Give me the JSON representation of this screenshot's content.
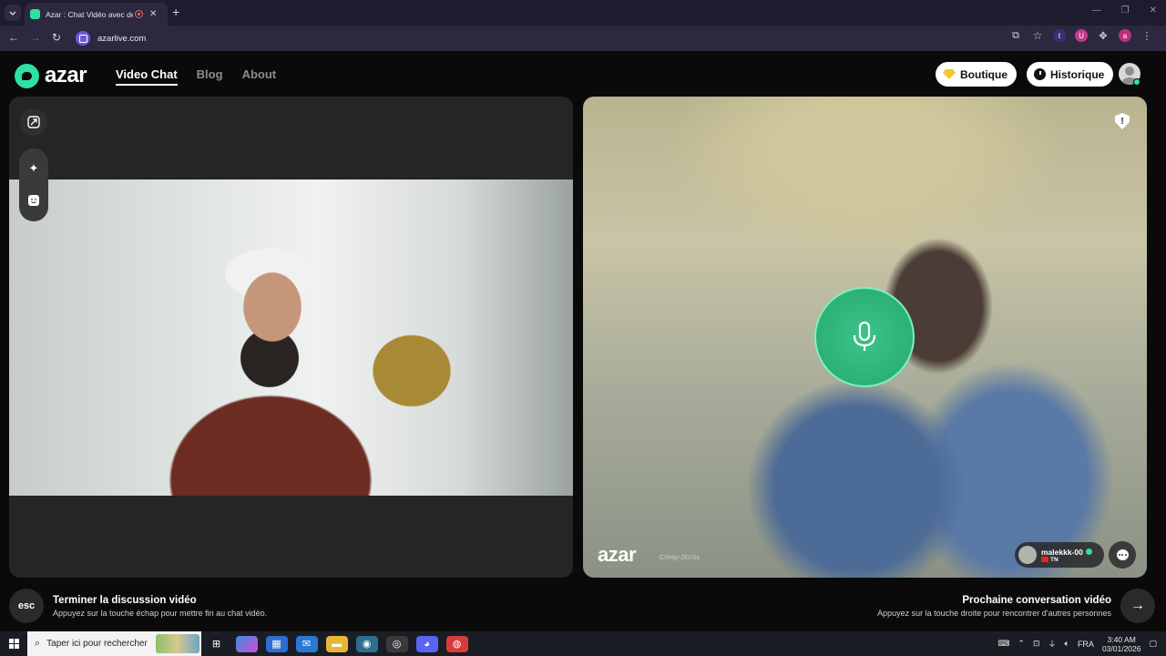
{
  "browser": {
    "tab_title": "Azar : Chat Vidéo avec de n",
    "new_tab": "+",
    "url": "azarlive.com",
    "extensions": [
      "t",
      "U",
      "a"
    ]
  },
  "site": {
    "logo": "azar",
    "nav": [
      {
        "label": "Video Chat",
        "active": true
      },
      {
        "label": "Blog"
      },
      {
        "label": "About"
      }
    ],
    "shop_label": "Boutique",
    "history_label": "Historique"
  },
  "remote": {
    "watermark": "azar",
    "watermark_id": "CXHg+JXXSs",
    "peer_name": "malekkk-00",
    "peer_country": "TN",
    "report_icon": "!"
  },
  "hints": {
    "esc_key": "esc",
    "end_title": "Terminer la discussion vidéo",
    "end_sub": "Appuyez sur la touche échap pour mettre fin au chat vidéo.",
    "next_title": "Prochaine conversation vidéo",
    "next_sub": "Appuyez sur la touche droite pour rencontrer d'autres personnes"
  },
  "taskbar": {
    "search_placeholder": "Taper ici pour rechercher",
    "language": "FRA",
    "time": "3:40 AM",
    "date": "03/01/2026"
  },
  "colors": {
    "brand": "#2fe0a3",
    "mic": "#2bb877"
  }
}
